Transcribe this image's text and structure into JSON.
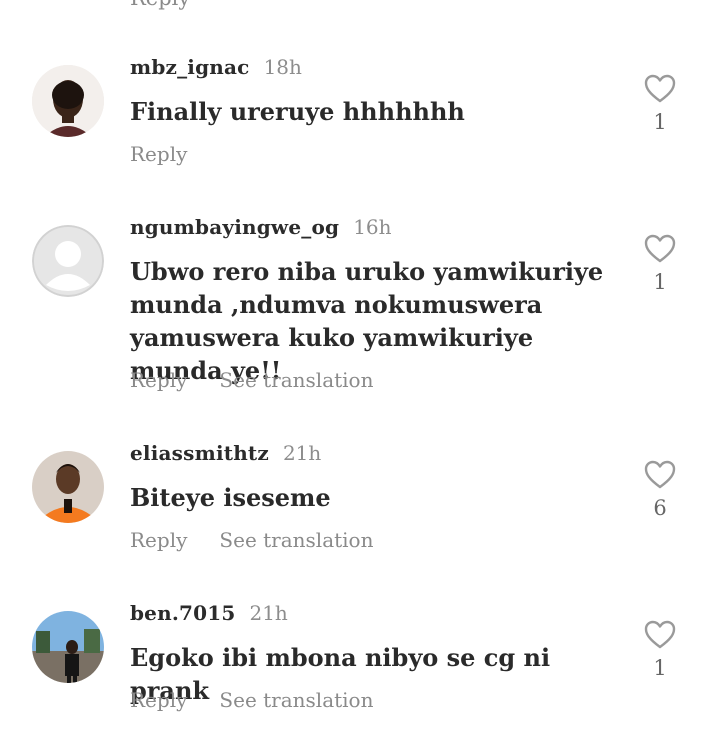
{
  "top_partial": {
    "reply_label": "Reply"
  },
  "comments": [
    {
      "username": "mbz_ignac",
      "time": "18h",
      "text": "Finally ureruye hhhhhhh",
      "reply_label": "Reply",
      "translate_label": "",
      "likes": "1"
    },
    {
      "username": "ngumbayingwe_og",
      "time": "16h",
      "text": "Ubwo rero niba uruko yamwikuriye munda ,ndumva nokumuswera yamuswera kuko yamwikuriye munda ye!!",
      "reply_label": "Reply",
      "translate_label": "See translation",
      "likes": "1"
    },
    {
      "username": "eliassmithtz",
      "time": "21h",
      "text": "Biteye iseseme",
      "reply_label": "Reply",
      "translate_label": "See translation",
      "likes": "6"
    },
    {
      "username": "ben.7015",
      "time": "21h",
      "text": "Egoko ibi mbona nibyo se cg ni prank",
      "reply_label": "Reply",
      "translate_label": "See translation",
      "likes": "1"
    }
  ],
  "icons": {
    "like": "heart-outline-icon"
  },
  "colors": {
    "secondary_text": "#8a8a8a",
    "heart_stroke": "#9a9a9a"
  }
}
